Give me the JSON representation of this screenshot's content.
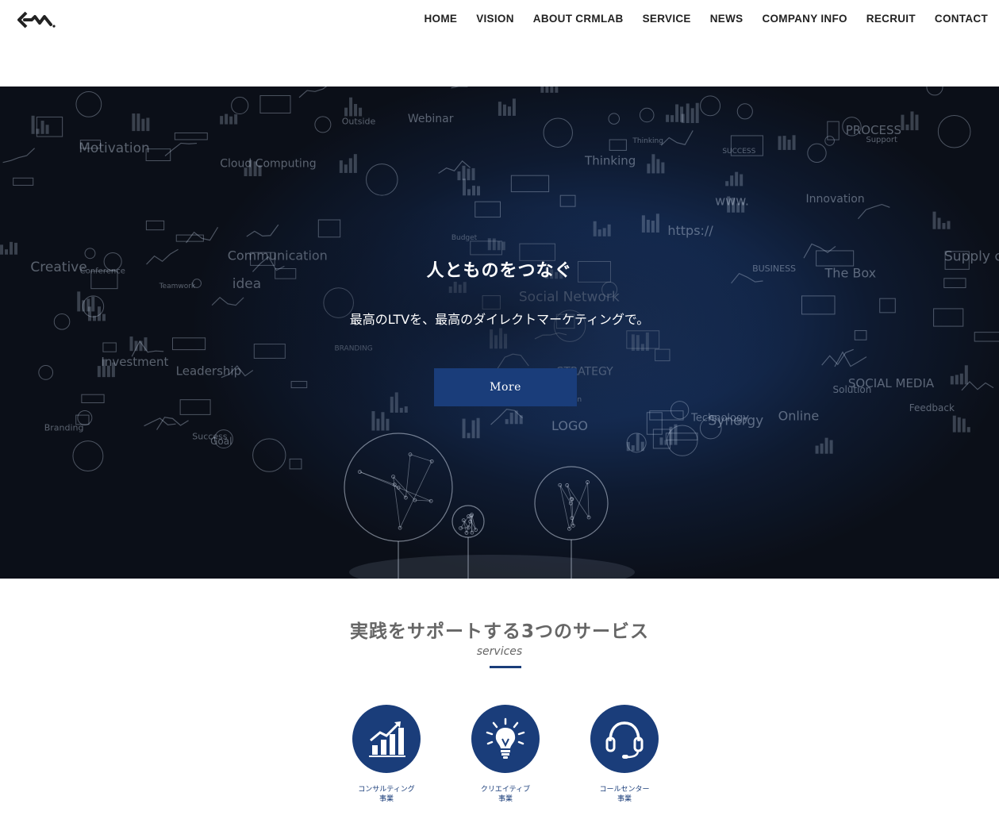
{
  "header": {
    "logo_alt": "crm",
    "nav": [
      {
        "label": "HOME"
      },
      {
        "label": "VISION"
      },
      {
        "label": "ABOUT CRMLAB"
      },
      {
        "label": "SERVICE"
      },
      {
        "label": "NEWS"
      },
      {
        "label": "COMPANY INFO"
      },
      {
        "label": "RECRUIT"
      },
      {
        "label": "CONTACT"
      }
    ]
  },
  "hero": {
    "title": "人とものをつなぐ",
    "subtitle": "最高のLTVを、最高のダイレクトマーケティングで。",
    "button_label": "More",
    "bg_words": [
      "Feedback",
      "Motivation",
      "Solution",
      "BUSINESS",
      "Communication",
      "Thinking",
      "Outside",
      "The Box",
      "LOGO",
      "SOCIAL MEDIA",
      "idea",
      "Creative",
      "Thinking",
      "STRATEGY",
      "Success",
      "Support",
      "Teamwork",
      "BRANDING",
      "PROCESS",
      "Goal",
      "Technology",
      "Innovation",
      "Supply chain",
      "Vision",
      "Branding",
      "SUCCESS",
      "Leadership",
      "https://",
      "www.",
      "Synergy",
      "Investment",
      "Cloud Computing",
      "Social Network",
      "Budget",
      "Webinar",
      "Online",
      "Conference"
    ]
  },
  "services": {
    "title": "実践をサポートする3つのサービス",
    "subtitle": "services",
    "items": [
      {
        "icon": "growth-chart-icon",
        "line1": "コンサルティング",
        "line2": "事業"
      },
      {
        "icon": "lightbulb-icon",
        "line1": "クリエイティブ",
        "line2": "事業"
      },
      {
        "icon": "headset-icon",
        "line1": "コールセンター",
        "line2": "事業"
      }
    ]
  },
  "colors": {
    "accent": "#1a3d7a",
    "hero_dark": "#0b0f18",
    "nav_text": "#222222",
    "heading_gray": "#666666"
  }
}
